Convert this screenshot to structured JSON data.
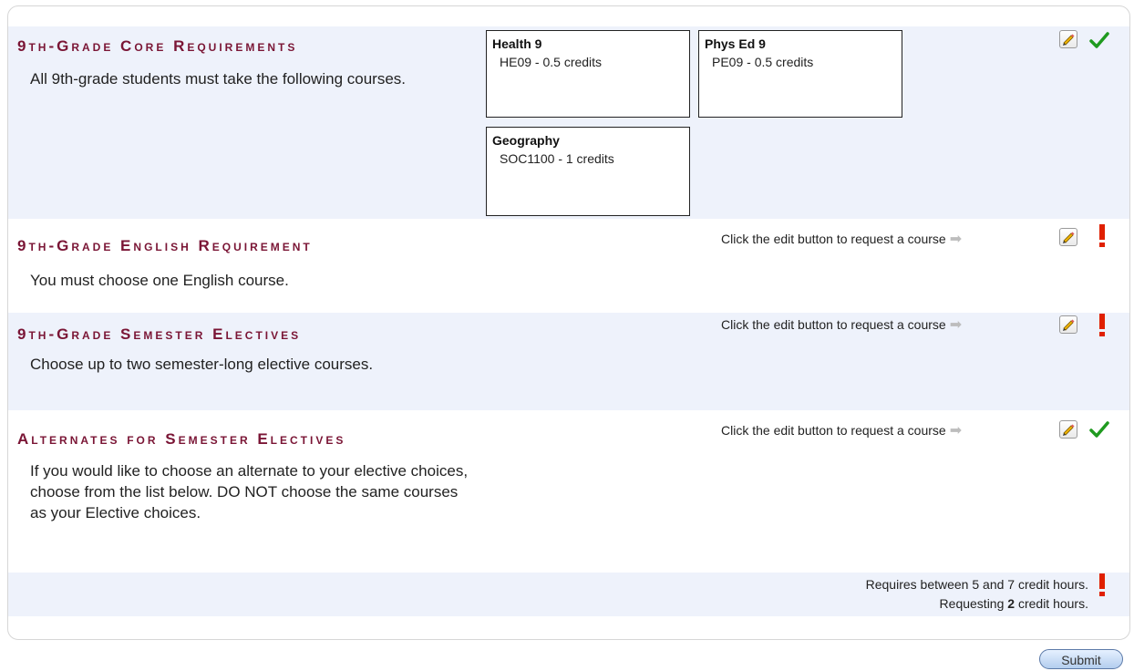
{
  "sections": [
    {
      "title": "9th-Grade Core Requirements",
      "description": "All 9th-grade students must take the following courses.",
      "courses": [
        {
          "name": "Health 9",
          "code": "HE09 - 0.5 credits"
        },
        {
          "name": "Phys Ed 9",
          "code": "PE09 - 0.5 credits"
        },
        {
          "name": "Geography",
          "code": "SOC1100 - 1 credits"
        }
      ],
      "status": "check"
    },
    {
      "title": "9th-Grade English Requirement",
      "description": "You must choose one English course.",
      "hint": "Click the edit button to request a course",
      "status": "warning"
    },
    {
      "title": "9th-Grade Semester Electives",
      "description": "Choose up to two semester-long elective courses.",
      "hint": "Click the edit button to request a course",
      "status": "warning"
    },
    {
      "title": "Alternates for Semester Electives",
      "description": "If you would like to choose an alternate to your elective choices, choose from the list below. DO NOT choose the same courses as your Elective choices.",
      "hint": "Click the edit button to request a course",
      "status": "check"
    }
  ],
  "summary": {
    "line1": "Requires between 5 and 7 credit hours.",
    "line2_prefix": "Requesting",
    "credits": "2",
    "line2_suffix": "credit hours."
  },
  "submit_label": "Submit",
  "icons": {
    "edit": "pencil-icon",
    "check": "check-icon",
    "warning": "exclamation-icon",
    "arrow": "right-arrow-icon"
  },
  "colors": {
    "title": "#7a1535",
    "check": "#1f9a1f",
    "warning": "#e02000",
    "shaded": "#eef2fb"
  }
}
